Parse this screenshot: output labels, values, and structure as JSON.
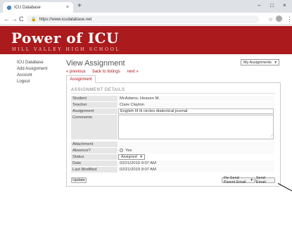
{
  "browser": {
    "tab_title": "ICU Database",
    "tab_close": "×",
    "new_tab": "+",
    "url": "https://www.icudatabase.net",
    "back": "←",
    "forward": "→",
    "reload": "C",
    "minimize": "–",
    "maximize": "□",
    "close": "×",
    "bookmark": "☆",
    "menu": "⋮"
  },
  "header": {
    "title": "Power of ICU",
    "subtitle": "HILL VALLEY HIGH SCHOOL"
  },
  "sidebar": {
    "items": [
      {
        "label": "ICU Database"
      },
      {
        "label": "Add Assignment"
      },
      {
        "label": "Account"
      },
      {
        "label": "Logout"
      }
    ]
  },
  "main": {
    "title": "View Assignment",
    "view_select": "My Assignments",
    "links": {
      "previous": "« previous",
      "back": "back to listings",
      "next": "next »"
    },
    "tab": "Assignment",
    "section": "ASSIGNMENT DETAILS",
    "fields": {
      "student_label": "Student",
      "student_value": "McAdams, Heaven M.",
      "teacher_label": "Teacher",
      "teacher_value": "Clare Clayton",
      "assignment_label": "Assignment",
      "assignment_value": "English III lit circles dialectical journal",
      "comments_label": "Comments",
      "attachment_label": "Attachment",
      "absence_label": "Absence?",
      "absence_option": "Yes",
      "status_label": "Status",
      "status_value": "Assigned",
      "date_label": "Date",
      "date_value": "02/21/2019 9:07 AM",
      "modified_label": "Last Modified",
      "modified_value": "02/21/2019 9:07 AM"
    },
    "buttons": {
      "update": "Update",
      "email_select": "Re-Send Parent Email",
      "send_email": "Send Email"
    }
  }
}
